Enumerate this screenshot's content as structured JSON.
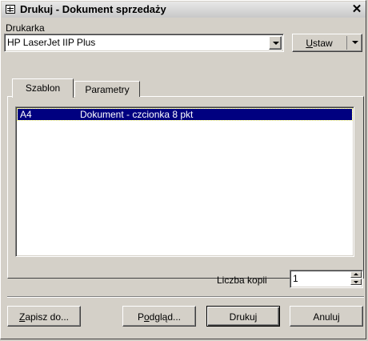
{
  "window": {
    "title": "Drukuj - Dokument sprzedaży",
    "close_label": "✕"
  },
  "printer": {
    "label": "Drukarka",
    "selected": "HP LaserJet IIP Plus",
    "setup_button": {
      "accel": "U",
      "rest": "staw"
    }
  },
  "tabs": [
    {
      "label": "Szablon",
      "active": true
    },
    {
      "label": "Parametry",
      "active": false
    }
  ],
  "templates": [
    {
      "code": "A4",
      "description": "Dokument - czcionka 8 pkt",
      "selected": true
    }
  ],
  "copies": {
    "label": "Liczba kopii",
    "value": "1"
  },
  "buttons": {
    "save_to": {
      "accel": "Z",
      "rest": "apisz do..."
    },
    "preview": {
      "pre": "P",
      "accel": "o",
      "rest": "dgląd..."
    },
    "print": "Drukuj",
    "cancel": "Anuluj"
  },
  "icons": {
    "window": "table-icon",
    "close": "close-icon",
    "dropdown": "chevron-down-icon"
  }
}
